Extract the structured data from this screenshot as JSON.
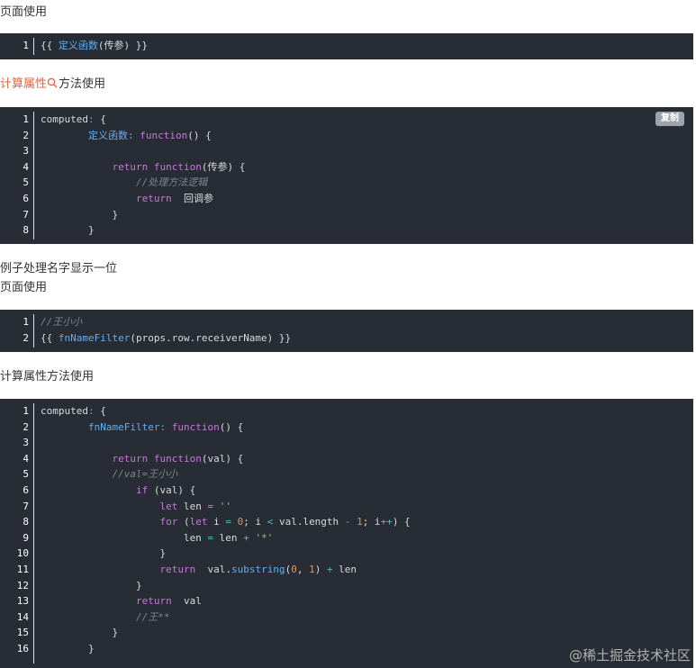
{
  "paragraphs": {
    "p1": "页面使用",
    "p2_link": "计算属性",
    "p2_rest": "方法使用",
    "p3": "例子处理名字显示一位",
    "p4": "页面使用",
    "p5": "计算属性方法使用"
  },
  "copy_button_label": "复制",
  "watermark": "@稀土掘金技术社区",
  "icons": {
    "search": "search-icon"
  },
  "colors": {
    "code_bg": "#282c34",
    "function": "#61afef",
    "keyword": "#c678dd",
    "comment": "#7f848e",
    "string": "#98c379",
    "number": "#d19a66",
    "operator": "#56b6c2",
    "link": "#e8603c"
  },
  "blocks": [
    {
      "lines": [
        [
          [
            "pl",
            "{{ "
          ],
          [
            "fn",
            "定义函数"
          ],
          [
            "pl",
            "(传参) }}"
          ]
        ]
      ]
    },
    {
      "lines": [
        [
          [
            "pl",
            "computed"
          ],
          [
            "op",
            ":"
          ],
          [
            "pl",
            " {"
          ]
        ],
        [
          [
            "pl",
            "        "
          ],
          [
            "fn",
            "定义函数"
          ],
          [
            "op",
            ":"
          ],
          [
            "pl",
            " "
          ],
          [
            "kw",
            "function"
          ],
          [
            "pl",
            "() {"
          ]
        ],
        [
          [
            "pl",
            ""
          ]
        ],
        [
          [
            "pl",
            "            "
          ],
          [
            "kw",
            "return"
          ],
          [
            "pl",
            " "
          ],
          [
            "kw",
            "function"
          ],
          [
            "pl",
            "(传参) {"
          ]
        ],
        [
          [
            "pl",
            "                "
          ],
          [
            "cm",
            "//处理方法逻辑"
          ]
        ],
        [
          [
            "pl",
            "                "
          ],
          [
            "kw",
            "return"
          ],
          [
            "pl",
            "  回调参"
          ]
        ],
        [
          [
            "pl",
            "            }"
          ]
        ],
        [
          [
            "pl",
            "        }"
          ]
        ]
      ]
    },
    {
      "lines": [
        [
          [
            "cm",
            "//王小小"
          ]
        ],
        [
          [
            "pl",
            "{{ "
          ],
          [
            "fn",
            "fnNameFilter"
          ],
          [
            "pl",
            "(props.row.receiverName) }}"
          ]
        ]
      ]
    },
    {
      "lines": [
        [
          [
            "pl",
            "computed"
          ],
          [
            "op",
            ":"
          ],
          [
            "pl",
            " {"
          ]
        ],
        [
          [
            "pl",
            "        "
          ],
          [
            "fn",
            "fnNameFilter"
          ],
          [
            "op",
            ":"
          ],
          [
            "pl",
            " "
          ],
          [
            "kw",
            "function"
          ],
          [
            "pl",
            "() {"
          ]
        ],
        [
          [
            "pl",
            ""
          ]
        ],
        [
          [
            "pl",
            "            "
          ],
          [
            "kw",
            "return"
          ],
          [
            "pl",
            " "
          ],
          [
            "kw",
            "function"
          ],
          [
            "pl",
            "(val) {"
          ]
        ],
        [
          [
            "pl",
            "            "
          ],
          [
            "cm",
            "//val=王小小"
          ]
        ],
        [
          [
            "pl",
            "                "
          ],
          [
            "kw",
            "if"
          ],
          [
            "pl",
            " (val) {"
          ]
        ],
        [
          [
            "pl",
            "                    "
          ],
          [
            "kw",
            "let"
          ],
          [
            "pl",
            " len "
          ],
          [
            "op",
            "="
          ],
          [
            "pl",
            " "
          ],
          [
            "str",
            "''"
          ]
        ],
        [
          [
            "pl",
            "                    "
          ],
          [
            "kw",
            "for"
          ],
          [
            "pl",
            " ("
          ],
          [
            "kw",
            "let"
          ],
          [
            "pl",
            " i "
          ],
          [
            "op",
            "="
          ],
          [
            "pl",
            " "
          ],
          [
            "num",
            "0"
          ],
          [
            "pl",
            "; i "
          ],
          [
            "op",
            "<"
          ],
          [
            "pl",
            " val.length "
          ],
          [
            "op",
            "-"
          ],
          [
            "pl",
            " "
          ],
          [
            "num",
            "1"
          ],
          [
            "pl",
            "; i"
          ],
          [
            "op",
            "++"
          ],
          [
            "pl",
            ") {"
          ]
        ],
        [
          [
            "pl",
            "                        len "
          ],
          [
            "op",
            "="
          ],
          [
            "pl",
            " len "
          ],
          [
            "op",
            "+"
          ],
          [
            "pl",
            " "
          ],
          [
            "str",
            "'*'"
          ]
        ],
        [
          [
            "pl",
            "                    }"
          ]
        ],
        [
          [
            "pl",
            "                    "
          ],
          [
            "kw",
            "return"
          ],
          [
            "pl",
            "  val."
          ],
          [
            "fn",
            "substring"
          ],
          [
            "pl",
            "("
          ],
          [
            "num",
            "0"
          ],
          [
            "pl",
            ", "
          ],
          [
            "num",
            "1"
          ],
          [
            "pl",
            ") "
          ],
          [
            "op",
            "+"
          ],
          [
            "pl",
            " len"
          ]
        ],
        [
          [
            "pl",
            "                }"
          ]
        ],
        [
          [
            "pl",
            "                "
          ],
          [
            "kw",
            "return"
          ],
          [
            "pl",
            "  val"
          ]
        ],
        [
          [
            "pl",
            "                "
          ],
          [
            "cm",
            "//王**"
          ]
        ],
        [
          [
            "pl",
            "            }"
          ]
        ],
        [
          [
            "pl",
            "        }"
          ]
        ]
      ]
    }
  ]
}
